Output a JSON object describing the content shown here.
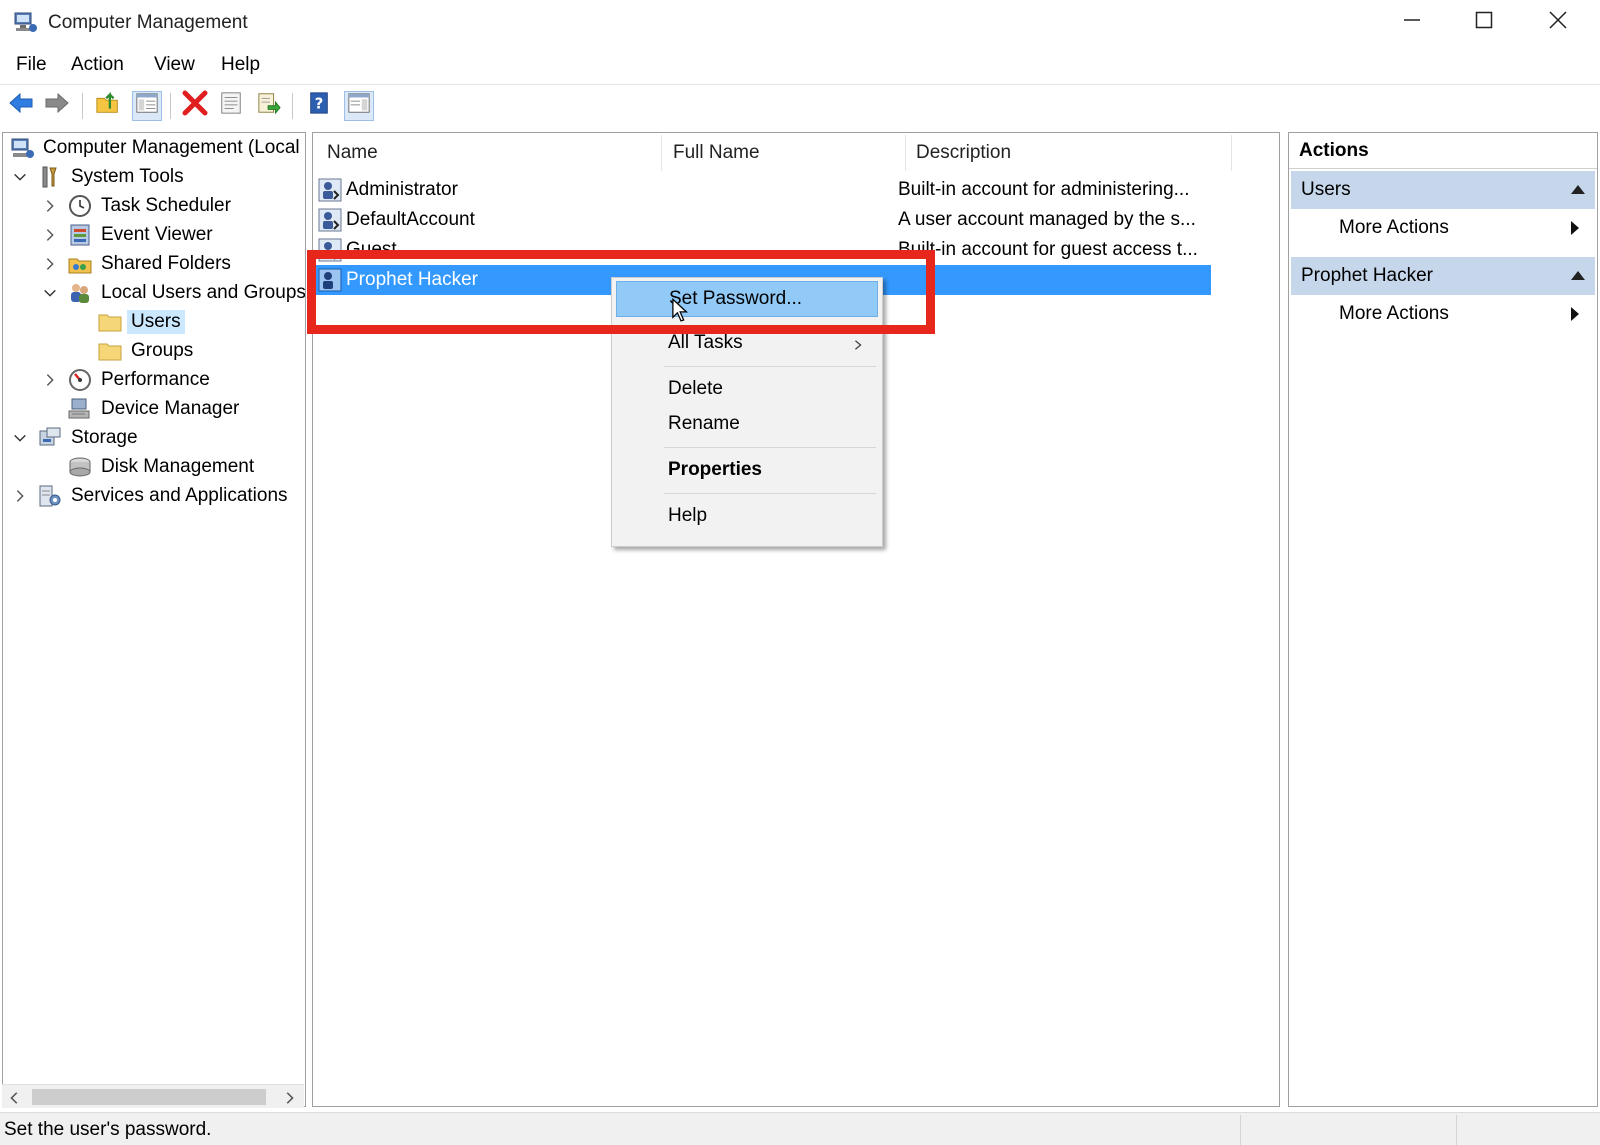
{
  "window": {
    "title": "Computer Management",
    "controls": [
      "minimize-icon",
      "maximize-icon",
      "close-icon"
    ]
  },
  "menu": [
    "File",
    "Action",
    "View",
    "Help"
  ],
  "toolbar": {
    "buttons": [
      "back-icon",
      "forward-icon",
      "up-folder-icon",
      "show-hide-console-tree-icon",
      "delete-icon",
      "properties-icon",
      "export-list-icon",
      "help-icon",
      "show-hide-action-pane-icon"
    ]
  },
  "tree": {
    "root": "Computer Management (Local",
    "system_tools": "System Tools",
    "task_scheduler": "Task Scheduler",
    "event_viewer": "Event Viewer",
    "shared_folders": "Shared Folders",
    "local_users_groups": "Local Users and Groups",
    "users": "Users",
    "groups": "Groups",
    "performance": "Performance",
    "device_manager": "Device Manager",
    "storage": "Storage",
    "disk_management": "Disk Management",
    "services_apps": "Services and Applications"
  },
  "list": {
    "columns": [
      "Name",
      "Full Name",
      "Description"
    ],
    "rows": [
      {
        "name": "Administrator",
        "full_name": "",
        "description": "Built-in account for administering..."
      },
      {
        "name": "DefaultAccount",
        "full_name": "",
        "description": "A user account managed by the s..."
      },
      {
        "name": "Guest",
        "full_name": "",
        "description": "Built-in account for guest access t..."
      },
      {
        "name": "Prophet Hacker",
        "full_name": "",
        "description": ""
      }
    ]
  },
  "context_menu": {
    "set_password": "Set Password...",
    "all_tasks": "All Tasks",
    "delete": "Delete",
    "rename": "Rename",
    "properties": "Properties",
    "help": "Help"
  },
  "actions": {
    "title": "Actions",
    "section1": "Users",
    "section1_item": "More Actions",
    "section2": "Prophet Hacker",
    "section2_item": "More Actions"
  },
  "status": {
    "text": "Set the user's password."
  },
  "colors": {
    "selection": "#3399ff",
    "highlight_box": "#e8271c",
    "menu_hover": "#91c9f7",
    "action_section": "#c6d7ec"
  }
}
